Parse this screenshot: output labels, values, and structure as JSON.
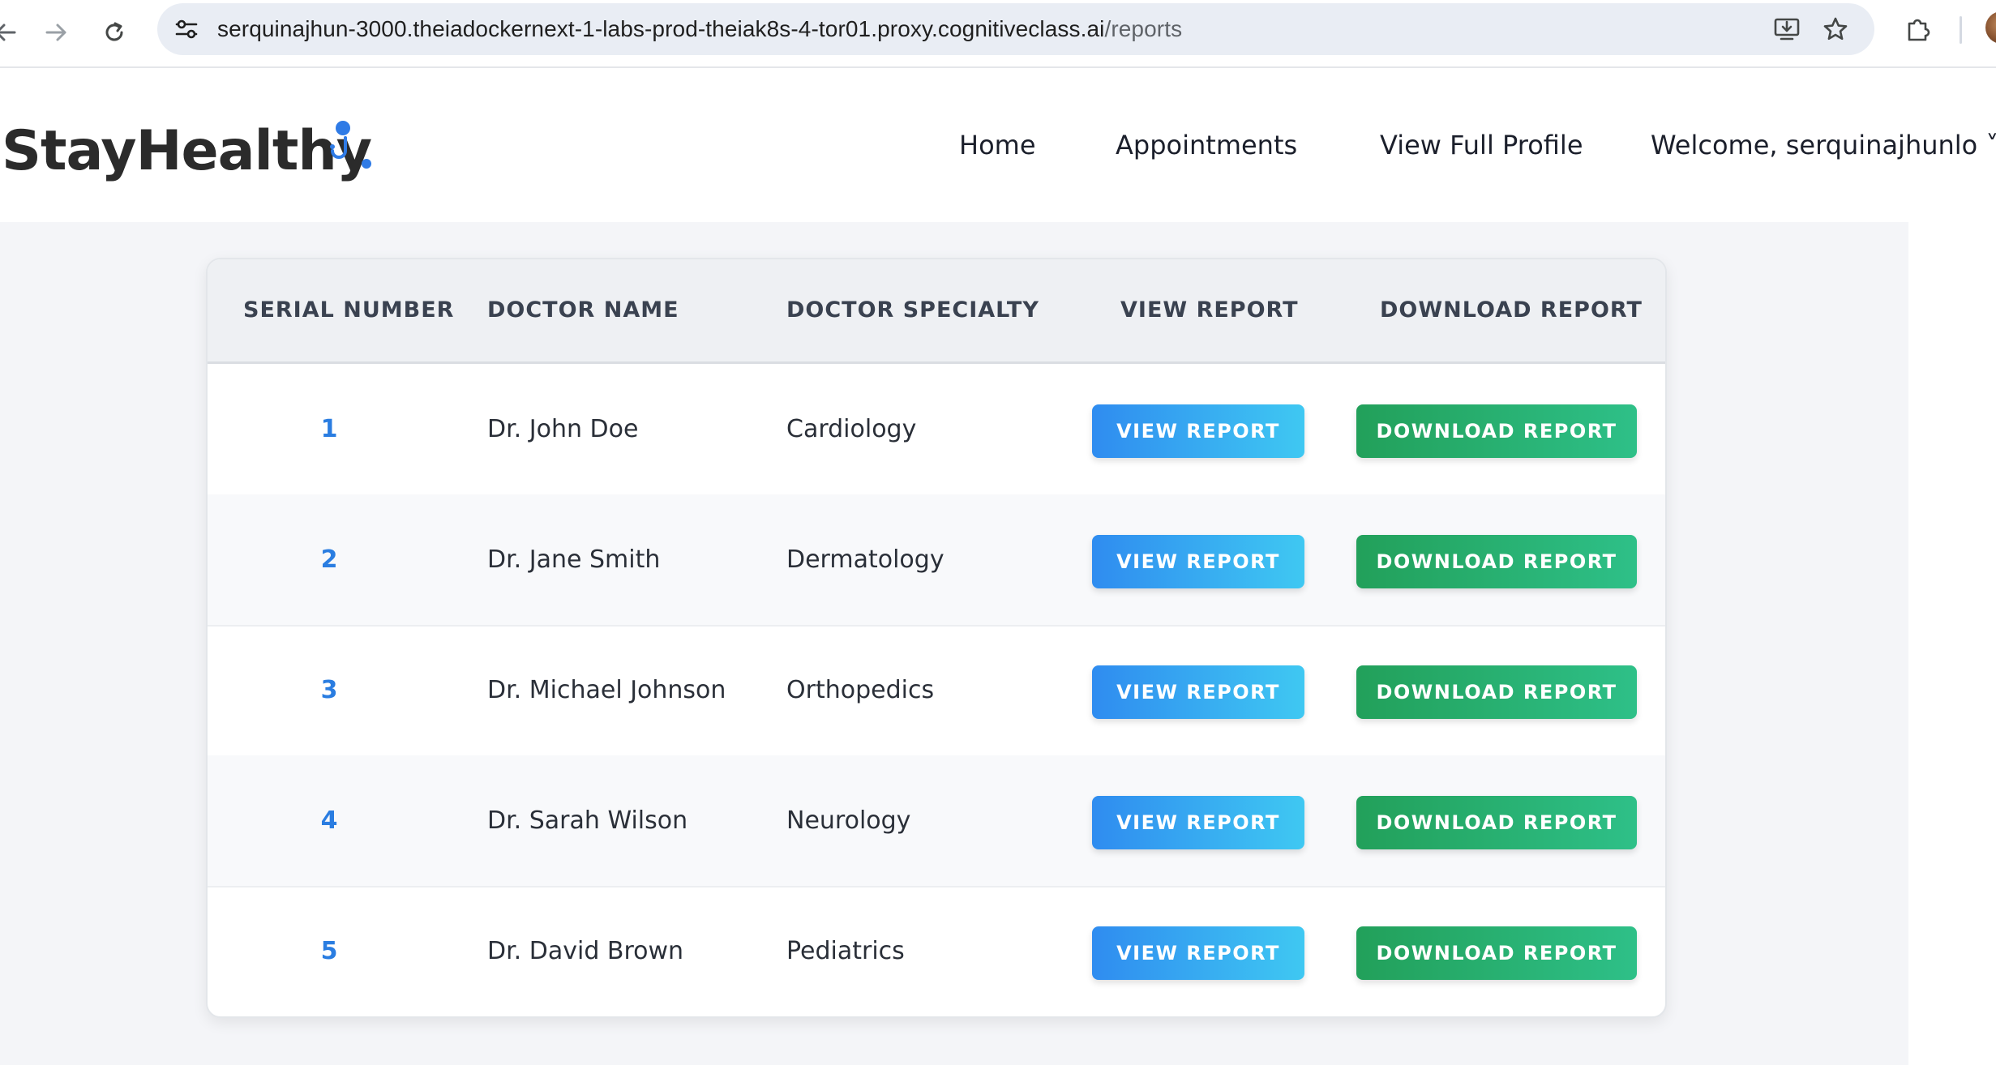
{
  "browser": {
    "url_host": "serquinajhun-3000.theiadockernext-1-labs-prod-theiak8s-4-tor01.proxy.cognitiveclass.ai",
    "url_path": "/reports"
  },
  "header": {
    "brand": "StayHealthy",
    "nav": [
      "Home",
      "Appointments",
      "View Full Profile",
      "Welcome, serquinajhunlo ˅"
    ]
  },
  "table": {
    "columns": [
      "SERIAL NUMBER",
      "DOCTOR NAME",
      "DOCTOR SPECIALTY",
      "VIEW REPORT",
      "DOWNLOAD REPORT"
    ],
    "rows": [
      {
        "serial": "1",
        "doctor": "Dr. John Doe",
        "specialty": "Cardiology",
        "view_label": "VIEW REPORT",
        "download_label": "DOWNLOAD REPORT"
      },
      {
        "serial": "2",
        "doctor": "Dr. Jane Smith",
        "specialty": "Dermatology",
        "view_label": "VIEW REPORT",
        "download_label": "DOWNLOAD REPORT"
      },
      {
        "serial": "3",
        "doctor": "Dr. Michael Johnson",
        "specialty": "Orthopedics",
        "view_label": "VIEW REPORT",
        "download_label": "DOWNLOAD REPORT"
      },
      {
        "serial": "4",
        "doctor": "Dr. Sarah Wilson",
        "specialty": "Neurology",
        "view_label": "VIEW REPORT",
        "download_label": "DOWNLOAD REPORT"
      },
      {
        "serial": "5",
        "doctor": "Dr. David Brown",
        "specialty": "Pediatrics",
        "view_label": "VIEW REPORT",
        "download_label": "DOWNLOAD REPORT"
      }
    ]
  },
  "colors": {
    "serial_accent": "#2a7de1",
    "view_button": "#2f8cf0",
    "download_button": "#22a05a",
    "brand_accent": "#2f7be6"
  },
  "icons": [
    "back-arrow-icon",
    "forward-arrow-icon",
    "reload-icon",
    "site-settings-icon",
    "install-app-icon",
    "bookmark-star-icon",
    "extensions-puzzle-icon",
    "stethoscope-icon"
  ]
}
